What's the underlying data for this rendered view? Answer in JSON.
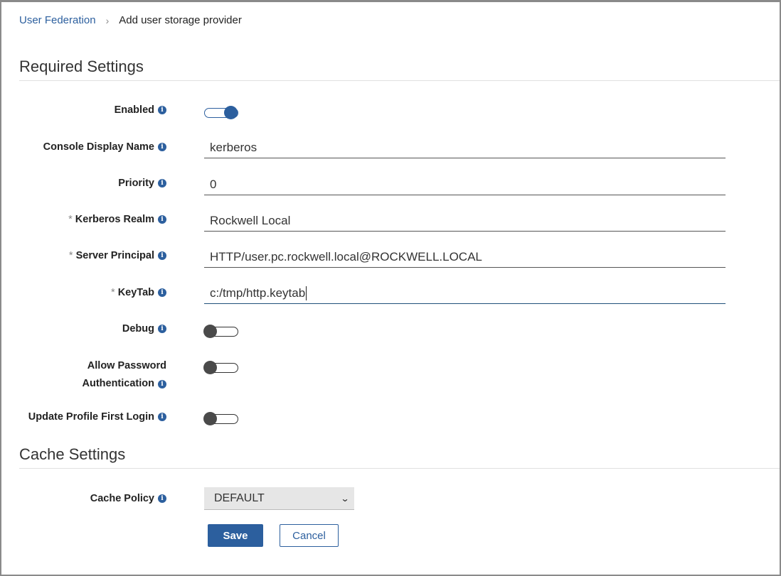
{
  "breadcrumb": {
    "parent": "User Federation",
    "separator": "›",
    "current": "Add user storage provider"
  },
  "sections": {
    "required": "Required Settings",
    "cache": "Cache Settings"
  },
  "fields": {
    "enabled": {
      "label": "Enabled",
      "value": true
    },
    "console_display_name": {
      "label": "Console Display Name",
      "value": "kerberos"
    },
    "priority": {
      "label": "Priority",
      "value": "0"
    },
    "kerberos_realm": {
      "label": "Kerberos Realm",
      "required": "*",
      "value": "Rockwell Local"
    },
    "server_principal": {
      "label": "Server Principal",
      "required": "*",
      "value": "HTTP/user.pc.rockwell.local@ROCKWELL.LOCAL"
    },
    "keytab": {
      "label": "KeyTab",
      "required": "*",
      "value": "c:/tmp/http.keytab"
    },
    "debug": {
      "label": "Debug",
      "value": false
    },
    "allow_password_auth": {
      "label_line1": "Allow Password",
      "label_line2": "Authentication",
      "value": false
    },
    "update_profile_first_login": {
      "label": "Update Profile First Login",
      "value": false
    },
    "cache_policy": {
      "label": "Cache Policy",
      "value": "DEFAULT"
    }
  },
  "buttons": {
    "save": "Save",
    "cancel": "Cancel"
  },
  "icons": {
    "info": "i",
    "chevron": "⌄"
  },
  "colors": {
    "accent": "#2c5f9e"
  }
}
